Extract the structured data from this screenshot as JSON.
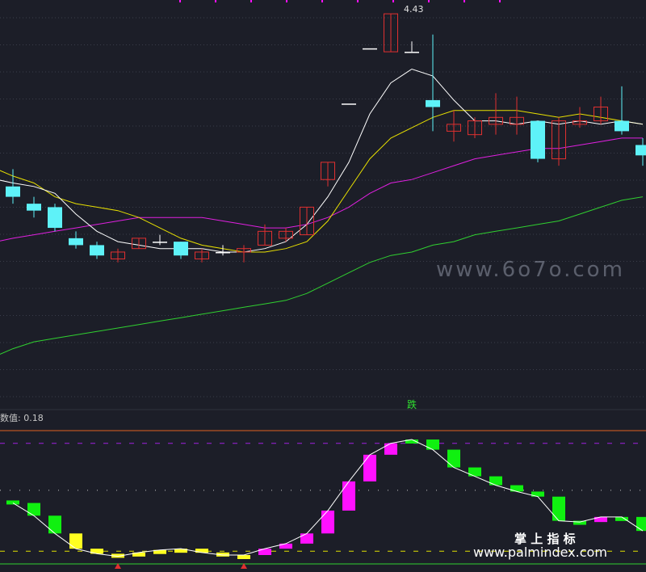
{
  "colors": {
    "background": "#1c1e28",
    "grid": "#3a3d4a",
    "up": "#e03030",
    "down": "#5ef2f8",
    "flat": "#ffffff",
    "ma_white": "#ffffff",
    "ma_yellow": "#e8e000",
    "ma_magenta": "#e020e0",
    "ma_green": "#30d030",
    "osc_up": "#ff10ff",
    "osc_down": "#10f010",
    "osc_low": "#ffff20",
    "osc_line": "#ffffff",
    "divider": "#e06020",
    "dash_high": "#a020e0",
    "dash_low": "#e0e000",
    "label_text": "#e0e0e0",
    "signal_text": "#30e030",
    "watermark": "#9aa0b0"
  },
  "top_label": "4.43",
  "signal_label": "跌",
  "indicator_label": "数值: 0.18",
  "watermark_main": "www.6o7o.com",
  "watermark_brand": "掌 上 指 标",
  "watermark_site": "www.palmindex.com",
  "chart_data": [
    {
      "type": "candlestick",
      "ylim": [
        3.3,
        4.47
      ],
      "grid": true,
      "candles": [
        {
          "o": 3.93,
          "h": 3.98,
          "l": 3.88,
          "c": 3.9
        },
        {
          "o": 3.88,
          "h": 3.9,
          "l": 3.84,
          "c": 3.86
        },
        {
          "o": 3.87,
          "h": 3.88,
          "l": 3.8,
          "c": 3.81
        },
        {
          "o": 3.78,
          "h": 3.8,
          "l": 3.75,
          "c": 3.76
        },
        {
          "o": 3.76,
          "h": 3.77,
          "l": 3.72,
          "c": 3.73
        },
        {
          "o": 3.72,
          "h": 3.75,
          "l": 3.71,
          "c": 3.74
        },
        {
          "o": 3.75,
          "h": 3.78,
          "l": 3.75,
          "c": 3.78
        },
        {
          "o": 3.77,
          "h": 3.79,
          "l": 3.76,
          "c": 3.77
        },
        {
          "o": 3.77,
          "h": 3.77,
          "l": 3.72,
          "c": 3.73
        },
        {
          "o": 3.72,
          "h": 3.75,
          "l": 3.71,
          "c": 3.74
        },
        {
          "o": 3.74,
          "h": 3.76,
          "l": 3.73,
          "c": 3.74
        },
        {
          "o": 3.74,
          "h": 3.76,
          "l": 3.71,
          "c": 3.75
        },
        {
          "o": 3.76,
          "h": 3.82,
          "l": 3.76,
          "c": 3.8
        },
        {
          "o": 3.78,
          "h": 3.81,
          "l": 3.77,
          "c": 3.8
        },
        {
          "o": 3.79,
          "h": 3.87,
          "l": 3.79,
          "c": 3.87
        },
        {
          "o": 3.95,
          "h": 4.0,
          "l": 3.93,
          "c": 4.0
        },
        {
          "o": 4.17,
          "h": 4.17,
          "l": 4.17,
          "c": 4.17
        },
        {
          "o": 4.33,
          "h": 4.33,
          "l": 4.33,
          "c": 4.33
        },
        {
          "o": 4.32,
          "h": 4.43,
          "l": 4.32,
          "c": 4.43
        },
        {
          "o": 4.32,
          "h": 4.35,
          "l": 4.32,
          "c": 4.32
        },
        {
          "o": 4.18,
          "h": 4.37,
          "l": 4.09,
          "c": 4.16
        },
        {
          "o": 4.09,
          "h": 4.15,
          "l": 4.06,
          "c": 4.11
        },
        {
          "o": 4.08,
          "h": 4.13,
          "l": 4.07,
          "c": 4.12
        },
        {
          "o": 4.11,
          "h": 4.2,
          "l": 4.08,
          "c": 4.13
        },
        {
          "o": 4.11,
          "h": 4.19,
          "l": 4.08,
          "c": 4.13
        },
        {
          "o": 4.12,
          "h": 4.12,
          "l": 4.0,
          "c": 4.01
        },
        {
          "o": 4.01,
          "h": 4.13,
          "l": 3.99,
          "c": 4.12
        },
        {
          "o": 4.11,
          "h": 4.16,
          "l": 4.1,
          "c": 4.12
        },
        {
          "o": 4.12,
          "h": 4.19,
          "l": 4.11,
          "c": 4.16
        },
        {
          "o": 4.12,
          "h": 4.22,
          "l": 4.08,
          "c": 4.09
        },
        {
          "o": 4.05,
          "h": 4.07,
          "l": 3.99,
          "c": 4.02
        }
      ],
      "ma_white": [
        3.94,
        3.93,
        3.91,
        3.85,
        3.8,
        3.77,
        3.76,
        3.75,
        3.75,
        3.75,
        3.74,
        3.74,
        3.75,
        3.77,
        3.82,
        3.9,
        4.0,
        4.14,
        4.23,
        4.27,
        4.25,
        4.18,
        4.12,
        4.12,
        4.11,
        4.12,
        4.11,
        4.12,
        4.11,
        4.12,
        4.11
      ],
      "ma_yellow": [
        3.96,
        3.94,
        3.9,
        3.88,
        3.87,
        3.86,
        3.84,
        3.81,
        3.78,
        3.76,
        3.75,
        3.74,
        3.74,
        3.75,
        3.77,
        3.83,
        3.92,
        4.01,
        4.07,
        4.1,
        4.13,
        4.15,
        4.15,
        4.15,
        4.15,
        4.14,
        4.13,
        4.14,
        4.13,
        4.12,
        4.11
      ],
      "ma_magenta": [
        3.78,
        3.79,
        3.8,
        3.81,
        3.82,
        3.83,
        3.84,
        3.84,
        3.84,
        3.84,
        3.83,
        3.82,
        3.81,
        3.81,
        3.82,
        3.84,
        3.87,
        3.91,
        3.94,
        3.95,
        3.97,
        3.99,
        4.01,
        4.02,
        4.03,
        4.04,
        4.04,
        4.05,
        4.06,
        4.07,
        4.07
      ],
      "ma_green": [
        3.46,
        3.48,
        3.49,
        3.5,
        3.51,
        3.52,
        3.53,
        3.54,
        3.55,
        3.56,
        3.57,
        3.58,
        3.59,
        3.6,
        3.62,
        3.65,
        3.68,
        3.71,
        3.73,
        3.74,
        3.76,
        3.77,
        3.79,
        3.8,
        3.81,
        3.82,
        3.83,
        3.85,
        3.87,
        3.89,
        3.9
      ]
    },
    {
      "type": "bar",
      "title": "数值",
      "ylim": [
        0,
        1.05
      ],
      "levels": {
        "high": 0.95,
        "low": 0.1,
        "mid": 0.58
      },
      "values": [
        0.48,
        0.38,
        0.24,
        0.12,
        0.08,
        0.06,
        0.09,
        0.11,
        0.12,
        0.09,
        0.07,
        0.07,
        0.12,
        0.16,
        0.24,
        0.42,
        0.65,
        0.86,
        0.95,
        0.98,
        0.9,
        0.76,
        0.69,
        0.62,
        0.57,
        0.53,
        0.34,
        0.33,
        0.37,
        0.37,
        0.26
      ],
      "colors": [
        "down",
        "down",
        "down",
        "low",
        "low",
        "low",
        "low",
        "low",
        "low",
        "low",
        "low",
        "low",
        "up",
        "up",
        "up",
        "up",
        "up",
        "up",
        "up",
        "down",
        "down",
        "down",
        "down",
        "down",
        "down",
        "down",
        "down",
        "down",
        "up",
        "down",
        "down"
      ]
    }
  ]
}
